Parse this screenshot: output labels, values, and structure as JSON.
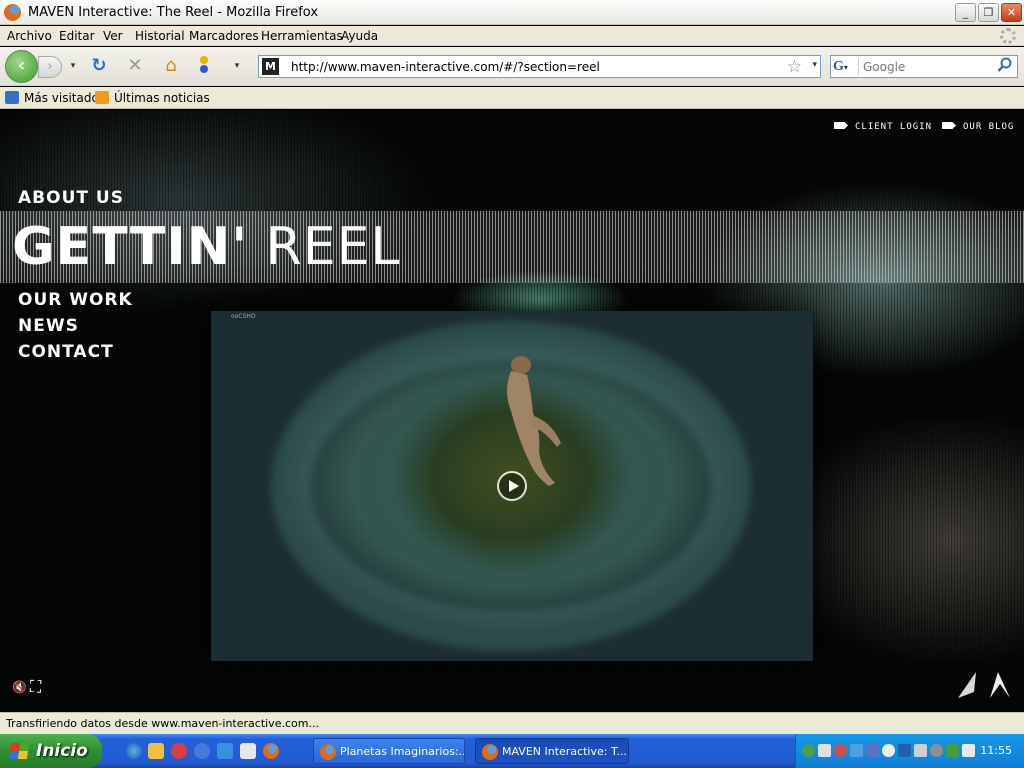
{
  "window": {
    "title": "MAVEN Interactive: The Reel - Mozilla Firefox",
    "minimize_glyph": "_",
    "maximize_glyph": "❐",
    "close_glyph": "✕"
  },
  "menu": {
    "items": [
      "Archivo",
      "Editar",
      "Ver",
      "Historial",
      "Marcadores",
      "Herramientas",
      "Ayuda"
    ]
  },
  "toolbar": {
    "back_glyph": "‹",
    "forward_glyph": "›",
    "reload_glyph": "↻",
    "stop_glyph": "✕",
    "home_glyph": "⌂",
    "url": "http://www.maven-interactive.com/#/?section=reel",
    "site_icon_letter": "M",
    "star_glyph": "☆",
    "search_engine_letter": "G",
    "search_placeholder": "Google"
  },
  "bookmarks": {
    "items": [
      "Más visitados",
      "Últimas noticias"
    ]
  },
  "site": {
    "top_links": [
      "CLIENT LOGIN",
      "OUR BLOG"
    ],
    "nav": [
      "ABOUT US",
      "OUR WORK",
      "NEWS",
      "CONTACT"
    ],
    "headline_bold": "GETTIN'",
    "headline_light": "REEL",
    "video_watermark": "ooCSHO",
    "mute_glyph": "🔇",
    "fullscreen_glyph": "⛶"
  },
  "status": {
    "text": "Transfiriendo datos desde www.maven-interactive.com..."
  },
  "taskbar": {
    "start_label": "Inicio",
    "tasks": [
      "Planetas Imaginarios:...",
      "MAVEN Interactive: T..."
    ],
    "clock": "11:55"
  },
  "colors": {
    "accent_green": "#3e9a2c",
    "taskbar_blue": "#225bd1",
    "tray_blue": "#0f7fd6"
  }
}
